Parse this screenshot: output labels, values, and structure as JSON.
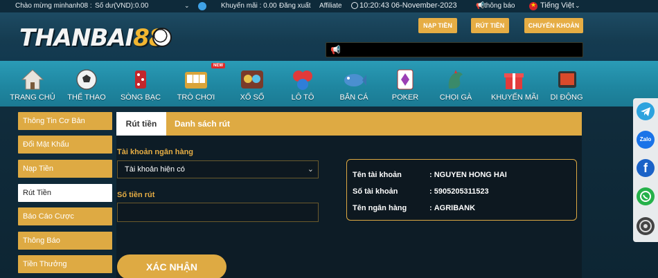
{
  "topbar": {
    "welcome": "Chào mừng minhanh08 :",
    "balance": "Số dư(VND):0.00",
    "promo": "Khuyến mãi : 0.00",
    "logout": "Đăng xuất",
    "affiliate": "Affiliate",
    "datetime": "10:20:43 06-November-2023",
    "notify": "thông báo",
    "language": "Tiếng Việt"
  },
  "header": {
    "logo_part1": "THANBAI",
    "logo_part2": "88",
    "deposit_label": "NẠP TIỀN",
    "withdraw_label": "RÚT TIỀN",
    "transfer_label": "CHUYỂN KHOẢN"
  },
  "nav": {
    "items": [
      {
        "label": "TRANG CHỦ",
        "icon": "house-icon"
      },
      {
        "label": "THỂ THAO",
        "icon": "soccer-icon"
      },
      {
        "label": "SÒNG BẠC",
        "icon": "casino-dice-icon"
      },
      {
        "label": "TRÒ CHƠI",
        "icon": "slot-machine-icon"
      },
      {
        "label": "XỔ SỐ",
        "icon": "lottery-icon"
      },
      {
        "label": "LÔ TÔ",
        "icon": "lotto-balls-icon"
      },
      {
        "label": "BẮN CÁ",
        "icon": "fish-icon"
      },
      {
        "label": "POKER",
        "icon": "poker-card-icon"
      },
      {
        "label": "CHỌI GÀ",
        "icon": "rooster-icon"
      },
      {
        "label": "KHUYẾN MÃI",
        "icon": "gift-icon"
      },
      {
        "label": "DI ĐỘNG",
        "icon": "mobile-icon"
      }
    ],
    "new_badge": "NEW"
  },
  "sidebar": {
    "items": [
      {
        "label": "Thông Tin Cơ Bản"
      },
      {
        "label": "Đổi Mật Khẩu"
      },
      {
        "label": "Nạp Tiền"
      },
      {
        "label": "Rút Tiền",
        "active": true
      },
      {
        "label": "Báo Cáo Cược"
      },
      {
        "label": "Thông Báo"
      },
      {
        "label": "Tiền Thưởng"
      }
    ]
  },
  "main": {
    "tabs": [
      {
        "label": "Rút tiền",
        "active": true
      },
      {
        "label": "Danh sách rút"
      }
    ],
    "bank_account_label": "Tài khoản ngân hàng",
    "bank_account_selected": "Tài khoản hiện có",
    "amount_label": "Số tiền rút",
    "amount_value": "",
    "submit_label": "XÁC NHẬN",
    "info": {
      "rows": [
        {
          "key": "Tên tài khoản",
          "value": "NGUYEN HONG HAI"
        },
        {
          "key": "Số tài khoản",
          "value": "5905205311523"
        },
        {
          "key": "Tên ngân hàng",
          "value": "AGRIBANK"
        }
      ]
    }
  },
  "social": {
    "items": [
      {
        "name": "telegram-icon",
        "color": "#2ea3de"
      },
      {
        "name": "zalo-icon",
        "color": "#1a73e8",
        "text": "Zalo"
      },
      {
        "name": "facebook-icon",
        "color": "#1a62c7",
        "text": "f"
      },
      {
        "name": "whatsapp-icon",
        "color": "#25b14a"
      },
      {
        "name": "phone-icon",
        "color": "#444444"
      }
    ]
  },
  "colors": {
    "gold": "#deaa43",
    "nav_teal": "#2a9bb6",
    "dark_bg": "#0d1c26"
  }
}
